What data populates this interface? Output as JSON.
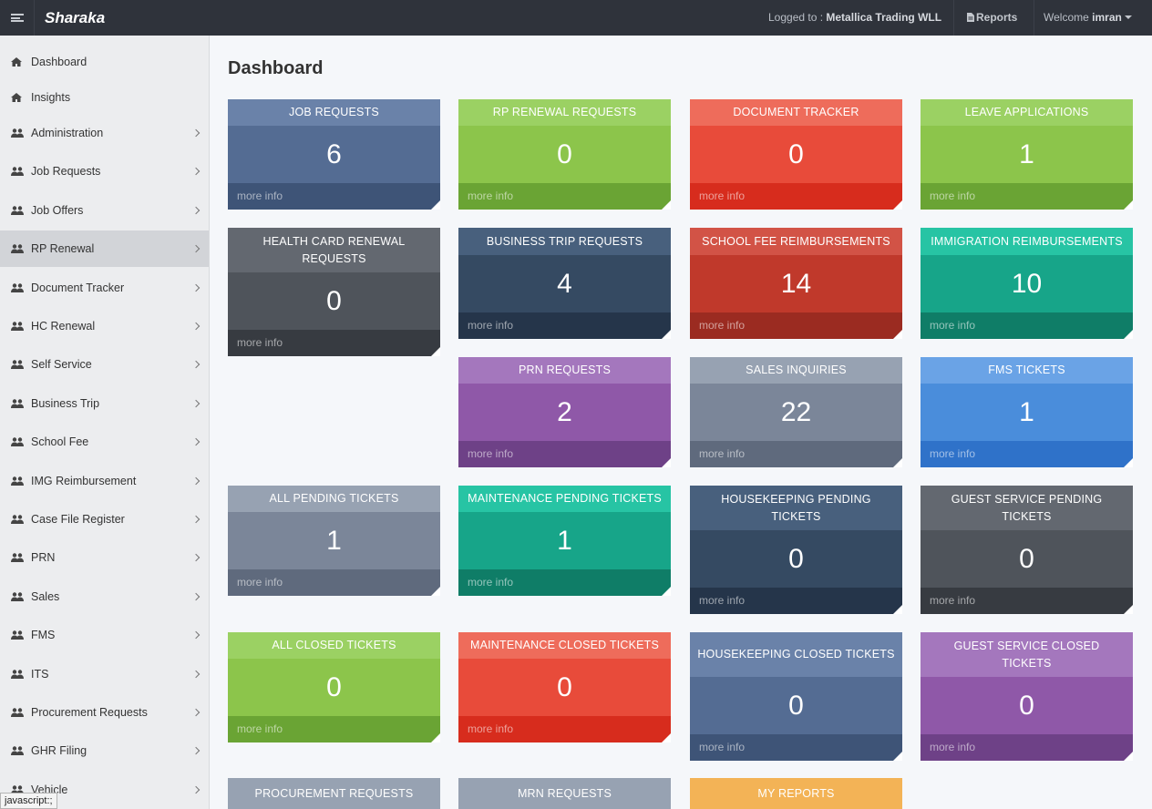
{
  "topbar": {
    "brand": "Sharaka",
    "logged_prefix": "Logged to : ",
    "company": "Metallica Trading WLL",
    "reports": "Reports",
    "welcome_prefix": "Welcome ",
    "user": "imran"
  },
  "sidebar": {
    "items": [
      {
        "label": "Dashboard",
        "icon": "home-icon",
        "chevron": false
      },
      {
        "label": "Insights",
        "icon": "home-icon",
        "chevron": false
      },
      {
        "label": "Administration",
        "icon": "users-icon",
        "chevron": true
      },
      {
        "label": "Job Requests",
        "icon": "users-icon",
        "chevron": true
      },
      {
        "label": "Job Offers",
        "icon": "users-icon",
        "chevron": true
      },
      {
        "label": "RP Renewal",
        "icon": "users-icon",
        "chevron": true,
        "active": true
      },
      {
        "label": "Document Tracker",
        "icon": "users-icon",
        "chevron": true
      },
      {
        "label": "HC Renewal",
        "icon": "users-icon",
        "chevron": true
      },
      {
        "label": "Self Service",
        "icon": "users-icon",
        "chevron": true
      },
      {
        "label": "Business Trip",
        "icon": "users-icon",
        "chevron": true
      },
      {
        "label": "School Fee",
        "icon": "users-icon",
        "chevron": true
      },
      {
        "label": "IMG Reimbursement",
        "icon": "users-icon",
        "chevron": true
      },
      {
        "label": "Case File Register",
        "icon": "users-icon",
        "chevron": true
      },
      {
        "label": "PRN",
        "icon": "users-icon",
        "chevron": true
      },
      {
        "label": "Sales",
        "icon": "users-icon",
        "chevron": true
      },
      {
        "label": "FMS",
        "icon": "users-icon",
        "chevron": true
      },
      {
        "label": "ITS",
        "icon": "users-icon",
        "chevron": true
      },
      {
        "label": "Procurement Requests",
        "icon": "users-icon",
        "chevron": true
      },
      {
        "label": "GHR Filing",
        "icon": "users-icon",
        "chevron": true
      },
      {
        "label": "Vehicle",
        "icon": "users-icon",
        "chevron": true
      }
    ],
    "status_tip": "javascript:;"
  },
  "main": {
    "title": "Dashboard",
    "more_info": "more info",
    "tiles": [
      {
        "title": "JOB REQUESTS",
        "value": "6",
        "color": "blue"
      },
      {
        "title": "RP RENEWAL REQUESTS",
        "value": "0",
        "color": "green"
      },
      {
        "title": "DOCUMENT TRACKER",
        "value": "0",
        "color": "red"
      },
      {
        "title": "LEAVE APPLICATIONS",
        "value": "1",
        "color": "green"
      },
      {
        "title": "HEALTH CARD RENEWAL REQUESTS",
        "value": "0",
        "color": "darkgray"
      },
      {
        "title": "BUSINESS TRIP REQUESTS",
        "value": "4",
        "color": "navy"
      },
      {
        "title": "SCHOOL FEE REIMBURSEMENTS",
        "value": "14",
        "color": "darkred"
      },
      {
        "title": "IMMIGRATION REIMBURSEMENTS",
        "value": "10",
        "color": "teal"
      },
      {
        "title": "PRN REQUESTS",
        "value": "2",
        "color": "purple"
      },
      {
        "title": "SALES INQUIRIES",
        "value": "22",
        "color": "gray"
      },
      {
        "title": "FMS TICKETS",
        "value": "1",
        "color": "skyblue"
      },
      {
        "title": "ALL PENDING TICKETS",
        "value": "1",
        "color": "gray"
      },
      {
        "title": "MAINTENANCE PENDING TICKETS",
        "value": "1",
        "color": "teal"
      },
      {
        "title": "HOUSEKEEPING PENDING TICKETS",
        "value": "0",
        "color": "navy"
      },
      {
        "title": "GUEST SERVICE PENDING TICKETS",
        "value": "0",
        "color": "darkgray"
      },
      {
        "title": "ALL CLOSED TICKETS",
        "value": "0",
        "color": "green"
      },
      {
        "title": "MAINTENANCE CLOSED TICKETS",
        "value": "0",
        "color": "red"
      },
      {
        "title": "HOUSEKEEPING CLOSED TICKETS",
        "value": "0",
        "color": "blue"
      },
      {
        "title": "GUEST SERVICE CLOSED TICKETS",
        "value": "0",
        "color": "purple"
      },
      {
        "title": "PROCUREMENT REQUESTS",
        "value": "",
        "color": "gray"
      },
      {
        "title": "MRN REQUESTS",
        "value": "",
        "color": "gray"
      },
      {
        "title": "MY REPORTS",
        "value": "",
        "color": "orange"
      }
    ]
  },
  "palette": {
    "blue": {
      "head": "#6a82a9",
      "body": "#546c93",
      "foot": "#3e5477"
    },
    "green": {
      "head": "#9bd163",
      "body": "#8cc54b",
      "foot": "#6aa434"
    },
    "red": {
      "head": "#ee6c5b",
      "body": "#e84b3a",
      "foot": "#d72c1d"
    },
    "darkgray": {
      "head": "#636870",
      "body": "#4f545b",
      "foot": "#373b41"
    },
    "navy": {
      "head": "#48607d",
      "body": "#354a62",
      "foot": "#25354a"
    },
    "darkred": {
      "head": "#d25346",
      "body": "#c0392b",
      "foot": "#9b2b21"
    },
    "teal": {
      "head": "#27c4a4",
      "body": "#17a589",
      "foot": "#0f7d67"
    },
    "purple": {
      "head": "#a477bd",
      "body": "#8f58a8",
      "foot": "#6e4187"
    },
    "gray": {
      "head": "#97a2b2",
      "body": "#7b8699",
      "foot": "#5f6a7d"
    },
    "skyblue": {
      "head": "#6aa3e6",
      "body": "#4a8ddb",
      "foot": "#2f72c9"
    },
    "orange": {
      "head": "#f3b356",
      "body": "#eea53c",
      "foot": "#d98c20"
    }
  }
}
